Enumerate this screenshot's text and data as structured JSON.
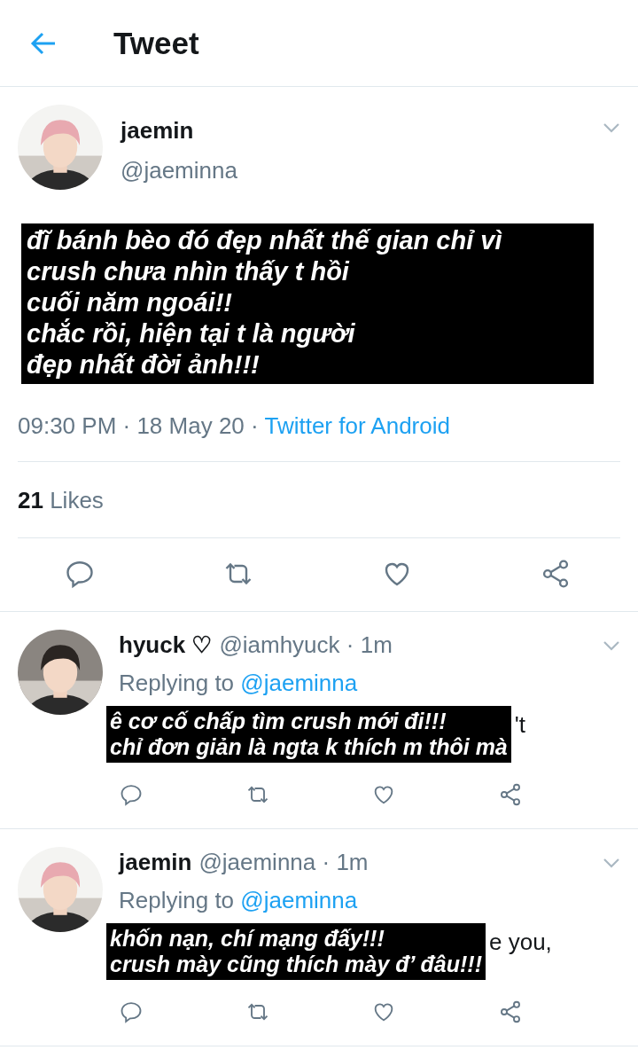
{
  "header": {
    "title": "Tweet"
  },
  "tweet": {
    "name": "jaemin",
    "handle": "@jaeminna",
    "caption": [
      "đĩ bánh bèo đó đẹp nhất thế gian chỉ vì",
      "crush chưa nhìn thấy t hồi",
      "cuối năm ngoái!!",
      "chắc rồi, hiện tại t là người",
      "đẹp nhất đời ảnh!!!"
    ],
    "time": "09:30 PM · 18 May 20 · ",
    "source": "Twitter for Android",
    "likes_count": "21",
    "likes_label": "Likes"
  },
  "replies": [
    {
      "name": "hyuck ♡",
      "handle": "@iamhyuck · 1m",
      "replying_label": "Replying to",
      "replying_to": "@jaeminna",
      "caption": [
        "ê cơ cố chấp tìm crush mới đi!!!",
        "chỉ đơn giản là ngta k thích m thôi mà"
      ],
      "visible_text": "'t"
    },
    {
      "name": "jaemin",
      "handle": "@jaeminna · 1m",
      "replying_label": "Replying to",
      "replying_to": "@jaeminna",
      "caption": [
        "khốn nạn, chí mạng đấy!!!",
        "crush mày cũng thích mày đ’ đâu!!!"
      ],
      "visible_text": "e you,"
    }
  ]
}
